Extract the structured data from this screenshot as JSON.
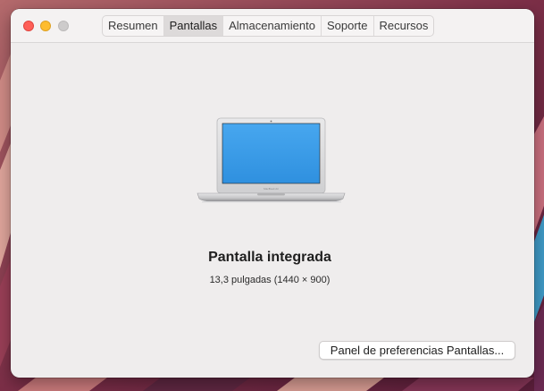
{
  "window": {
    "tabs": [
      {
        "label": "Resumen"
      },
      {
        "label": "Pantallas"
      },
      {
        "label": "Almacenamiento"
      },
      {
        "label": "Soporte"
      },
      {
        "label": "Recursos"
      }
    ],
    "active_tab": "Pantallas"
  },
  "display": {
    "name": "Pantalla integrada",
    "spec": "13,3 pulgadas (1440 × 900)",
    "laptop_screen_color": "#3e9fe9"
  },
  "actions": {
    "preferences_button": "Panel de preferencias Pantallas..."
  },
  "icons": {
    "close": "close-window-icon",
    "minimize": "minimize-window-icon",
    "zoom": "zoom-window-icon",
    "laptop": "macbook-air-icon"
  }
}
